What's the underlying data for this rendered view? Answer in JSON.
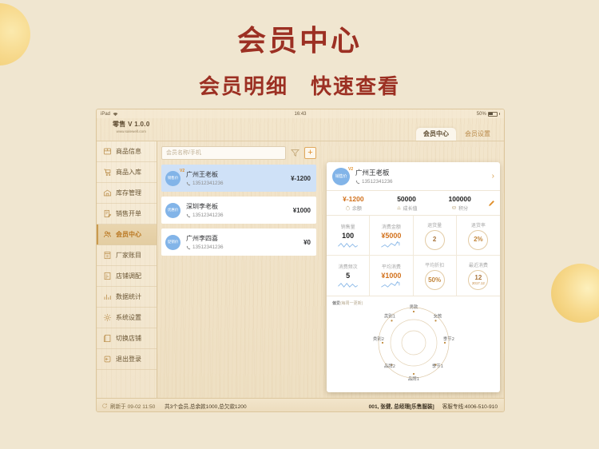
{
  "banner": {
    "title": "会员中心",
    "subtitle": "会员明细　快速查看"
  },
  "statusbar": {
    "device": "iPad",
    "wifi_icon": "wifi-icon",
    "time": "16:43",
    "battery_percent": "50%"
  },
  "brand": {
    "name": "零售 V 1.0.0",
    "url": "www.salewell.com"
  },
  "tabs": [
    {
      "label": "会员中心",
      "active": true
    },
    {
      "label": "会员设置",
      "active": false
    }
  ],
  "sidebar": {
    "items": [
      {
        "label": "商品信息",
        "icon": "box-icon",
        "active": false
      },
      {
        "label": "商品入库",
        "icon": "cart-icon",
        "active": false
      },
      {
        "label": "库存管理",
        "icon": "warehouse-icon",
        "active": false
      },
      {
        "label": "销售开单",
        "icon": "invoice-icon",
        "active": false
      },
      {
        "label": "会员中心",
        "icon": "members-icon",
        "active": true
      },
      {
        "label": "厂家账目",
        "icon": "ledger-icon",
        "active": false
      },
      {
        "label": "店铺调配",
        "icon": "transfer-icon",
        "active": false
      },
      {
        "label": "数据统计",
        "icon": "chart-icon",
        "active": false
      },
      {
        "label": "系统设置",
        "icon": "gear-icon",
        "active": false
      },
      {
        "label": "切换店铺",
        "icon": "switch-store-icon",
        "active": false
      },
      {
        "label": "退出登录",
        "icon": "logout-icon",
        "active": false
      }
    ]
  },
  "search": {
    "placeholder": "会员名称/手机",
    "value": "",
    "filter_icon": "filter-icon",
    "add_label": "+"
  },
  "member_list": [
    {
      "avatar_label": "销售价",
      "name": "广州王老板",
      "phone": "13512341236",
      "amount": "¥-1200",
      "selected": true,
      "vip": "V2"
    },
    {
      "avatar_label": "优惠价",
      "name": "深圳李老板",
      "phone": "13512341236",
      "amount": "¥1000",
      "selected": false,
      "vip": ""
    },
    {
      "avatar_label": "促销价",
      "name": "广州李四喜",
      "phone": "13512341236",
      "amount": "¥0",
      "selected": false,
      "vip": ""
    }
  ],
  "detail": {
    "header": {
      "avatar_label": "销售价",
      "name": "广州王老板",
      "phone": "13512341236",
      "vip": "V2",
      "chevron": "›"
    },
    "account": [
      {
        "value": "¥-1200",
        "label": "余额",
        "icon": "wallet-icon",
        "accent": true
      },
      {
        "value": "50000",
        "label": "成长值",
        "icon": "bell-icon",
        "accent": false
      },
      {
        "value": "100000",
        "label": "积分",
        "icon": "coins-icon",
        "accent": false
      }
    ],
    "edit_icon": "pencil-icon",
    "grid": [
      {
        "label": "销售量",
        "value": "100",
        "style": "spark-wave"
      },
      {
        "label": "消费金额",
        "value": "¥5000",
        "style": "spark-up"
      },
      {
        "label": "退货量",
        "value": "2",
        "style": "ring-arrow"
      },
      {
        "label": "退货率",
        "value": "2%",
        "style": "ring"
      },
      {
        "label": "消费频次",
        "value": "5",
        "style": "spark-wave"
      },
      {
        "label": "平均消费",
        "value": "¥1000",
        "style": "spark-up"
      },
      {
        "label": "平均折扣",
        "value": "50%",
        "style": "ring"
      },
      {
        "label": "最近消费",
        "value": "12",
        "sub": "2017.12",
        "style": "ring-date"
      }
    ]
  },
  "chart_data": {
    "type": "radar",
    "title": "偏爱",
    "subtitle": "(每周一更新)",
    "categories": [
      "男款",
      "女款",
      "季节2",
      "季节1",
      "品牌1",
      "品牌2",
      "类别2",
      "类别1"
    ],
    "values": [
      1,
      1,
      1,
      1,
      1,
      1,
      1,
      1
    ],
    "rings": 3,
    "grid": true,
    "legend": "none"
  },
  "bottombar": {
    "refresh": "刷新于 09-02 11:50",
    "refresh_icon": "refresh-icon",
    "summary": "共3个会员,总余款1000,总欠款1200",
    "user": "001, 张健, 总经理[乐售服装]",
    "service": "客服专线:4006-510-910"
  },
  "colors": {
    "page_bg": "#f0e6d0",
    "brand_red": "#9c3023",
    "accent_orange": "#d2711c",
    "selected_blue": "#cfe1f7",
    "avatar_blue": "#82b4e8"
  }
}
